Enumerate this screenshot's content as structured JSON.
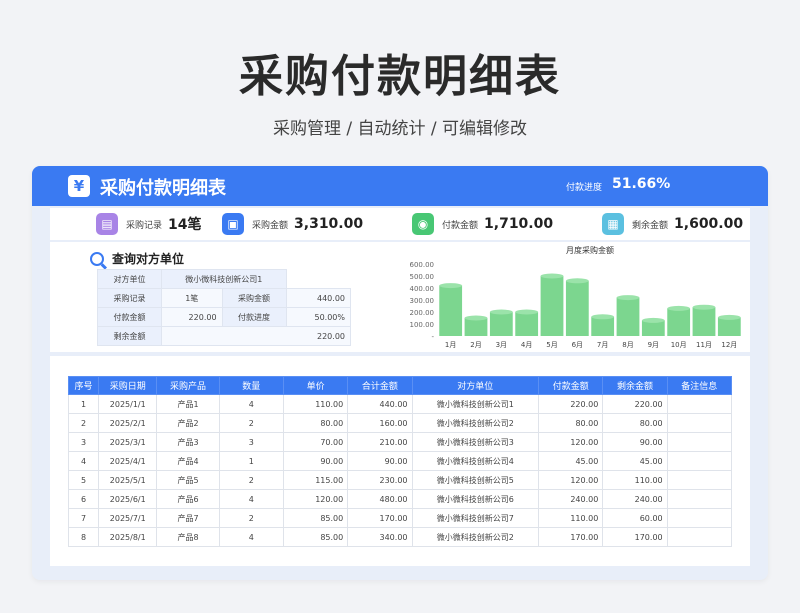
{
  "hero": {
    "title": "采购付款明细表",
    "subtitle": "采购管理 /  自动统计  /  可编辑修改"
  },
  "header": {
    "icon": "yen-icon",
    "icon_glyph": "¥",
    "title": "采购付款明细表",
    "progress_label": "付款进度",
    "progress_value": "51.66%"
  },
  "stats": [
    {
      "icon": "record-icon",
      "glyph": "▤",
      "color": "#a884e6",
      "label": "采购记录",
      "value": "14笔"
    },
    {
      "icon": "amount-icon",
      "glyph": "▣",
      "color": "#3a7af2",
      "label": "采购金额",
      "value": "3,310.00"
    },
    {
      "icon": "paid-icon",
      "glyph": "◉",
      "color": "#48c774",
      "label": "付款金额",
      "value": "1,710.00"
    },
    {
      "icon": "remain-icon",
      "glyph": "▦",
      "color": "#5bc0e0",
      "label": "剩余金额",
      "value": "1,600.00"
    }
  ],
  "query": {
    "title": "查询对方单位",
    "row1": {
      "label": "对方单位",
      "value": "微小微科技创新公司1"
    },
    "row2": {
      "label1": "采购记录",
      "value1": "1笔",
      "label2": "采购金额",
      "value2": "440.00"
    },
    "row3": {
      "label1": "付款金额",
      "value1": "220.00",
      "label2": "付款进度",
      "value2": "50.00%"
    },
    "row4": {
      "label": "剩余金额",
      "value": "220.00"
    }
  },
  "chart_data": {
    "type": "bar",
    "title": "月度采购金额",
    "categories": [
      "1月",
      "2月",
      "3月",
      "4月",
      "5月",
      "6月",
      "7月",
      "8月",
      "9月",
      "10月",
      "11月",
      "12月"
    ],
    "values": [
      420,
      150,
      200,
      200,
      500,
      460,
      160,
      320,
      130,
      230,
      240,
      155
    ],
    "ylim": [
      0,
      600
    ],
    "yticks": [
      "-",
      "100.00",
      "200.00",
      "300.00",
      "400.00",
      "500.00",
      "600.00"
    ],
    "color": "#7cd68f"
  },
  "table": {
    "headers": [
      "序号",
      "采购日期",
      "采购产品",
      "数量",
      "单价",
      "合计金额",
      "对方单位",
      "付款金额",
      "剩余金额",
      "备注信息"
    ],
    "rows": [
      [
        "1",
        "2025/1/1",
        "产品1",
        "4",
        "110.00",
        "440.00",
        "微小微科技创新公司1",
        "220.00",
        "220.00",
        ""
      ],
      [
        "2",
        "2025/2/1",
        "产品2",
        "2",
        "80.00",
        "160.00",
        "微小微科技创新公司2",
        "80.00",
        "80.00",
        ""
      ],
      [
        "3",
        "2025/3/1",
        "产品3",
        "3",
        "70.00",
        "210.00",
        "微小微科技创新公司3",
        "120.00",
        "90.00",
        ""
      ],
      [
        "4",
        "2025/4/1",
        "产品4",
        "1",
        "90.00",
        "90.00",
        "微小微科技创新公司4",
        "45.00",
        "45.00",
        ""
      ],
      [
        "5",
        "2025/5/1",
        "产品5",
        "2",
        "115.00",
        "230.00",
        "微小微科技创新公司5",
        "120.00",
        "110.00",
        ""
      ],
      [
        "6",
        "2025/6/1",
        "产品6",
        "4",
        "120.00",
        "480.00",
        "微小微科技创新公司6",
        "240.00",
        "240.00",
        ""
      ],
      [
        "7",
        "2025/7/1",
        "产品7",
        "2",
        "85.00",
        "170.00",
        "微小微科技创新公司7",
        "110.00",
        "60.00",
        ""
      ],
      [
        "8",
        "2025/8/1",
        "产品8",
        "4",
        "85.00",
        "340.00",
        "微小微科技创新公司2",
        "170.00",
        "170.00",
        ""
      ]
    ]
  }
}
